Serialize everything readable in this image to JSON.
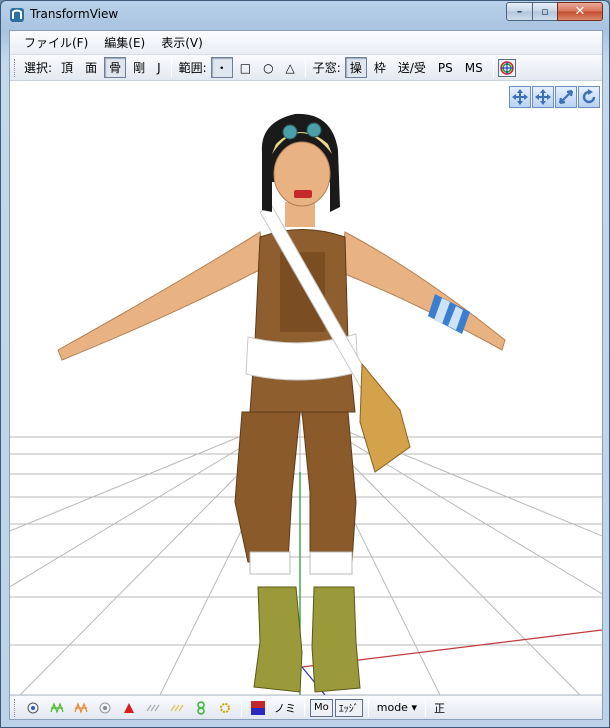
{
  "window": {
    "title": "TransformView"
  },
  "menubar": {
    "items": [
      "ファイル(F)",
      "編集(E)",
      "表示(V)"
    ]
  },
  "toolbar": {
    "select_label": "選択:",
    "select_modes": [
      "頂",
      "面",
      "骨",
      "剛",
      "J"
    ],
    "select_active": "骨",
    "range_label": "範囲:",
    "range_modes": [
      "・",
      "□",
      "○",
      "△"
    ],
    "child_label": "子窓:",
    "child_buttons": [
      "操",
      "枠",
      "送/受",
      "PS",
      "MS"
    ],
    "child_active": "操"
  },
  "statusbar": {
    "nomi_label": "ノミ",
    "mo_label": "Mo",
    "edge_label": "ｴｯｼﾞ",
    "mode_label": "mode",
    "sei_label": "正"
  },
  "colors": {
    "accent": "#3f6fb5",
    "grid": "#b8b8b8",
    "axis_x": "#c23a3a",
    "axis_y": "#2e9a3a",
    "axis_z": "#3a3ac2"
  }
}
